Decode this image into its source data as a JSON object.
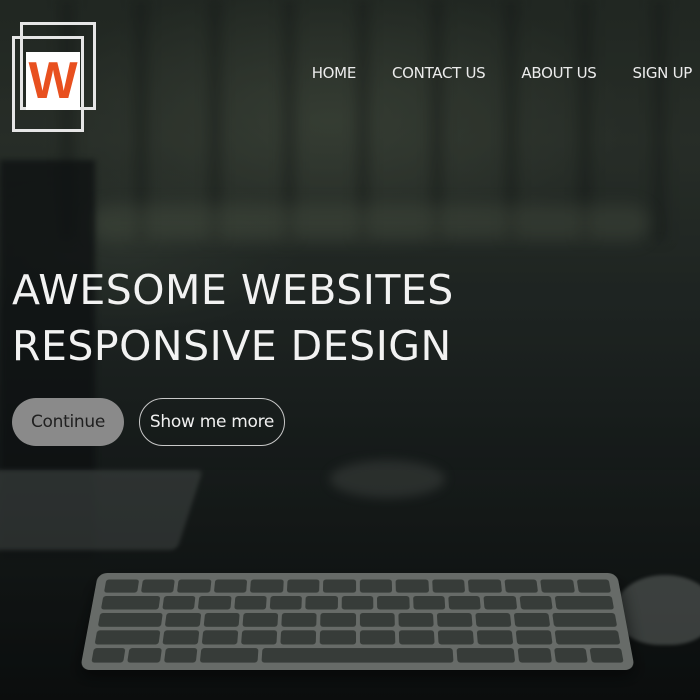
{
  "brand": {
    "logo_letter": "W",
    "logo_letter_color": "#e8501f"
  },
  "nav": {
    "items": [
      {
        "label": "HOME"
      },
      {
        "label": "CONTACT US"
      },
      {
        "label": "ABOUT US"
      },
      {
        "label": "SIGN UP"
      }
    ]
  },
  "hero": {
    "title_line1": "AWESOME WEBSITES",
    "title_line2": "RESPONSIVE DESIGN",
    "primary_button_label": "Continue",
    "secondary_button_label": "Show me more"
  }
}
